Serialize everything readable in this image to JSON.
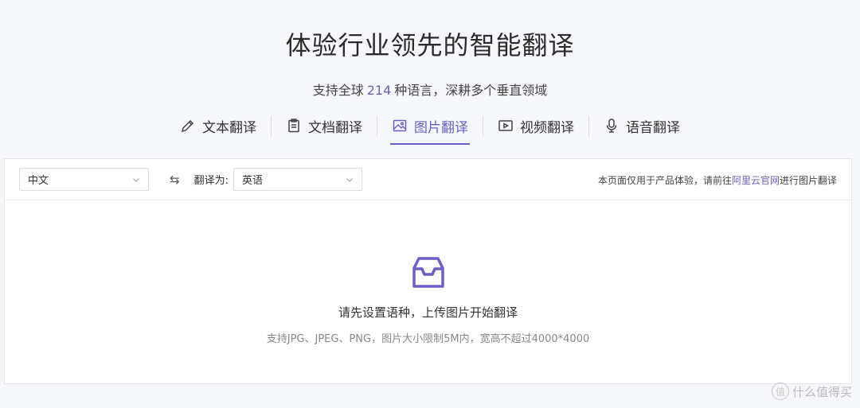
{
  "hero": {
    "title": "体验行业领先的智能翻译",
    "sub_prefix": "支持全球",
    "sub_count": "214",
    "sub_suffix": "种语言，深耕多个垂直领域"
  },
  "tabs": [
    {
      "label": "文本翻译",
      "icon": "pencil-icon",
      "active": false
    },
    {
      "label": "文档翻译",
      "icon": "clipboard-icon",
      "active": false
    },
    {
      "label": "图片翻译",
      "icon": "image-icon",
      "active": true
    },
    {
      "label": "视频翻译",
      "icon": "video-icon",
      "active": false
    },
    {
      "label": "语音翻译",
      "icon": "microphone-icon",
      "active": false
    }
  ],
  "toolbar": {
    "source_lang": "中文",
    "swap_icon": "⇆",
    "to_label": "翻译为:",
    "target_lang": "英语",
    "notice_prefix": "本页面仅用于产品体验，请前往",
    "notice_link": "阿里云官网",
    "notice_suffix": "进行图片翻译"
  },
  "empty_state": {
    "icon": "inbox-icon",
    "message": "请先设置语种，上传图片开始翻译",
    "hint": "支持JPG、JPEG、PNG，图片大小限制5M内，宽高不超过4000*4000"
  },
  "watermark": {
    "badge": "值",
    "text": "什么值得买"
  },
  "colors": {
    "accent": "#6c5fc7",
    "background": "#f6f7fb"
  }
}
